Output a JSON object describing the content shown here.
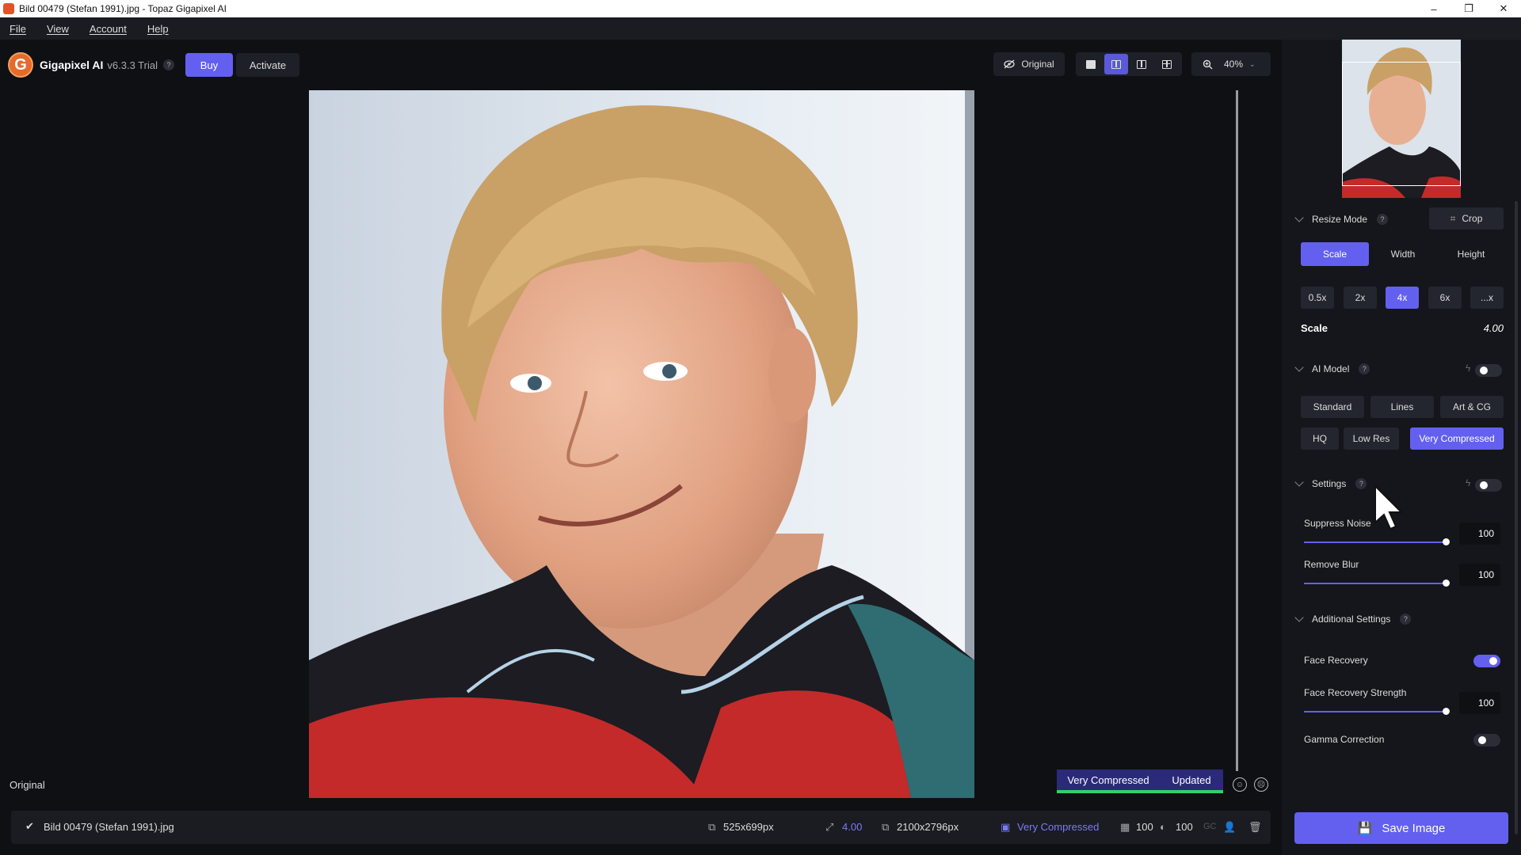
{
  "window": {
    "title": "Bild 00479 (Stefan 1991).jpg - Topaz Gigapixel AI",
    "minimize": "–",
    "restore": "❐",
    "close": "✕"
  },
  "menu": {
    "items": [
      "File",
      "View",
      "Account",
      "Help"
    ]
  },
  "toolbar": {
    "logo_letter": "G",
    "app_name": "Gigapixel AI",
    "version": "v6.3.3 Trial",
    "help": "?",
    "buy_label": "Buy",
    "activate_label": "Activate",
    "original_label": "Original",
    "zoom_value": "40%"
  },
  "canvas": {
    "original_label": "Original",
    "model_badge": "Very Compressed",
    "updated_badge": "Updated"
  },
  "statusbar": {
    "file_name": "Bild 00479 (Stefan 1991).jpg",
    "input_size": "525x699px",
    "scale": "4.00",
    "output_size": "2100x2796px",
    "model": "Very Compressed",
    "noise": "100",
    "blur": "100",
    "gc": "GC"
  },
  "sidebar": {
    "resize_mode": {
      "title": "Resize Mode",
      "crop_label": "Crop",
      "tabs": [
        "Scale",
        "Width",
        "Height"
      ],
      "active_tab": 0
    },
    "scale_presets": [
      "0.5x",
      "2x",
      "4x",
      "6x",
      "...x"
    ],
    "active_preset": 2,
    "scale_label": "Scale",
    "scale_value": "4.00",
    "ai_model": {
      "title": "AI Model",
      "row1": [
        "Standard",
        "Lines",
        "Art & CG"
      ],
      "row2": [
        "HQ",
        "Low Res",
        "Very Compressed"
      ],
      "active": "Very Compressed",
      "auto_enabled": false
    },
    "settings": {
      "title": "Settings",
      "auto_enabled": false,
      "suppress_noise": {
        "label": "Suppress Noise",
        "value": "100",
        "fraction": 1.0
      },
      "remove_blur": {
        "label": "Remove Blur",
        "value": "100",
        "fraction": 1.0
      }
    },
    "additional": {
      "title": "Additional Settings",
      "face_recovery": {
        "label": "Face Recovery",
        "enabled": true
      },
      "face_strength": {
        "label": "Face Recovery Strength",
        "value": "100",
        "fraction": 1.0
      },
      "gamma": {
        "label": "Gamma Correction",
        "enabled": false
      }
    },
    "save_label": "Save Image"
  },
  "colors": {
    "accent": "#6360f0",
    "badge_bg": "#2b2a78",
    "updated_line": "#2fd16a"
  }
}
